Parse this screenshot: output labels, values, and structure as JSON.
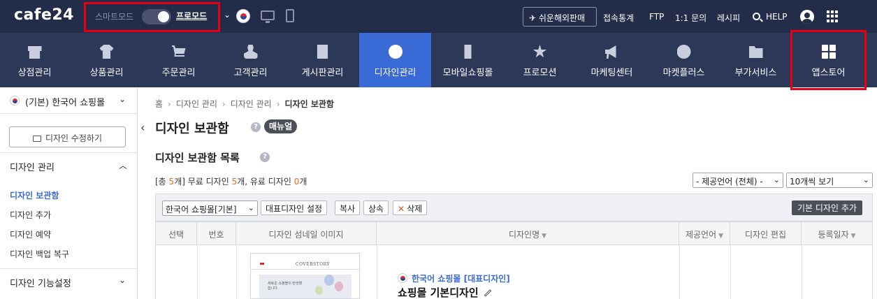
{
  "topbar": {
    "logo": "cafe24",
    "mode_smart": "스마트모드",
    "mode_pro": "프로모드",
    "global_sale": "쉬운해외판매",
    "links": [
      "접속통계",
      "FTP",
      "1:1 문의",
      "레시피"
    ],
    "help": "HELP"
  },
  "nav": {
    "items": [
      {
        "label": "상점관리",
        "icon": "store-icon"
      },
      {
        "label": "상품관리",
        "icon": "shirt-icon"
      },
      {
        "label": "주문관리",
        "icon": "cart-icon"
      },
      {
        "label": "고객관리",
        "icon": "person-icon"
      },
      {
        "label": "게시판관리",
        "icon": "board-icon"
      },
      {
        "label": "디자인관리",
        "icon": "palette-icon",
        "active": true
      },
      {
        "label": "모바일쇼핑몰",
        "icon": "phone-icon"
      },
      {
        "label": "프로모션",
        "icon": "star-icon"
      },
      {
        "label": "마케팅센터",
        "icon": "megaphone-icon"
      },
      {
        "label": "마켓플러스",
        "icon": "share-icon"
      },
      {
        "label": "부가서비스",
        "icon": "folder-plus-icon"
      },
      {
        "label": "앱스토어",
        "icon": "apps-grid-icon"
      }
    ]
  },
  "sidebar": {
    "shop": "(기본) 한국어 쇼핑몰",
    "edit_button": "디자인 수정하기",
    "section1": "디자인 관리",
    "links": [
      "디자인 보관함",
      "디자인 추가",
      "디자인 예약",
      "디자인 백업 복구"
    ],
    "section2": "디자인 기능설정"
  },
  "content": {
    "breadcrumb": [
      "홈",
      "디자인 관리",
      "디자인 관리",
      "디자인 보관함"
    ],
    "title": "디자인 보관함",
    "manual": "매뉴얼",
    "section_title": "디자인 보관함 목록",
    "summary": {
      "prefix": "[총 ",
      "total": "5",
      "mid1": "개] 무료 디자인 ",
      "free": "5",
      "mid2": "개, 유료 디자인 ",
      "paid": "0",
      "suffix": "개"
    },
    "language_filter": "- 제공언어 (전체) -",
    "per_page": "10개씩 보기",
    "toolbar": {
      "shop_select": "한국어 쇼핑몰[기본]",
      "set_main": "대표디자인 설정",
      "copy": "복사",
      "inherit": "상속",
      "delete": "삭제",
      "add_basic": "기본 디자인 추가"
    },
    "columns": [
      "선택",
      "번호",
      "디자인 섬네일 이미지",
      "디자인명",
      "제공언어",
      "디자인 편집",
      "등록일자"
    ],
    "row": {
      "label": "한국어 쇼핑몰 [대표디자인]",
      "name": "쇼핑몰 기본디자인",
      "thumb_brand": "COVERSTORY",
      "thumb_text": "새로운 쇼핑몰이 탄생했습니다."
    }
  },
  "colors": {
    "topbar": "#232c48",
    "nav": "#2d3859",
    "active": "#3a6ad6",
    "highlight": "#e60012",
    "orange": "#ef6d1f"
  }
}
